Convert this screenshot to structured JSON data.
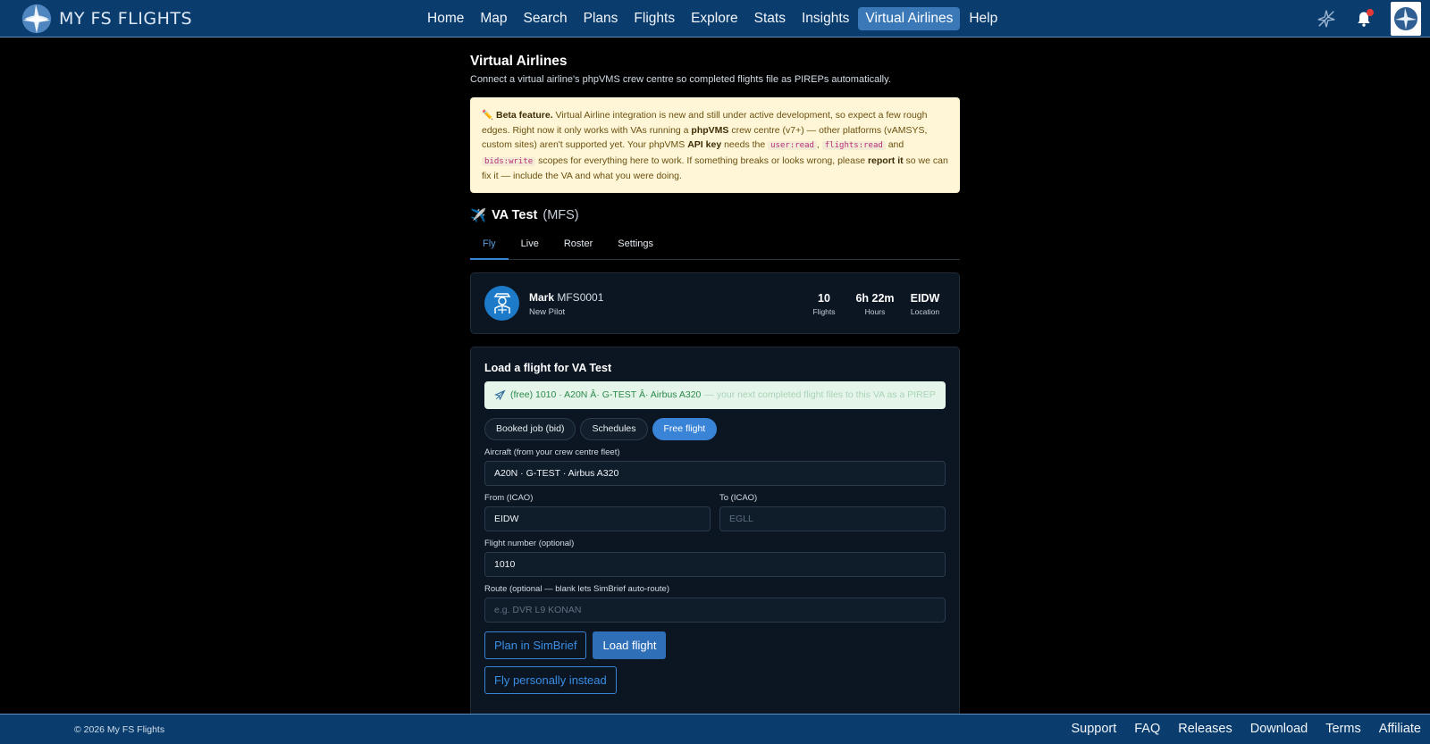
{
  "brand": {
    "name": "MY FS FLIGHTS"
  },
  "nav": {
    "items": [
      {
        "label": "Home"
      },
      {
        "label": "Map"
      },
      {
        "label": "Search"
      },
      {
        "label": "Plans"
      },
      {
        "label": "Flights"
      },
      {
        "label": "Explore"
      },
      {
        "label": "Stats"
      },
      {
        "label": "Insights"
      },
      {
        "label": "Virtual Airlines"
      },
      {
        "label": "Help"
      }
    ],
    "active": "Virtual Airlines"
  },
  "page": {
    "title": "Virtual Airlines",
    "subtitle": "Connect a virtual airline's phpVMS crew centre so completed flights file as PIREPs automatically."
  },
  "beta": {
    "label": "Beta feature.",
    "text1": " Virtual Airline integration is new and still under active development, so expect a few rough edges. Right now it only works with VAs running a ",
    "strong1": "phpVMS",
    "text2": " crew centre (v7+) — other platforms (vAMSYS, custom sites) aren't supported yet. Your phpVMS ",
    "strong2": "API key",
    "text3": " needs the ",
    "code1": "user:read",
    "sep1": ", ",
    "code2": "flights:read",
    "text4": " and ",
    "code3": "bids:write",
    "text5": " scopes for everything here to work. If something breaks or looks wrong, please ",
    "strong3": "report it",
    "text6": " so we can fix it — include the VA and what you were doing."
  },
  "va": {
    "name": "VA Test",
    "code": "(MFS)"
  },
  "tabs": [
    {
      "label": "Fly"
    },
    {
      "label": "Live"
    },
    {
      "label": "Roster"
    },
    {
      "label": "Settings"
    }
  ],
  "pilot": {
    "name": "Mark",
    "id": "MFS0001",
    "rank": "New Pilot",
    "stats": [
      {
        "value": "10",
        "label": "Flights"
      },
      {
        "value": "6h 22m",
        "label": "Hours"
      },
      {
        "value": "EIDW",
        "label": "Location"
      }
    ]
  },
  "load": {
    "title": "Load a flight for VA Test",
    "summary": "(free) 1010 · A20N Â· G-TEST Â· Airbus A320",
    "summary_hint": "— your next completed flight files to this VA as a PIREP",
    "modes": [
      {
        "label": "Booked job (bid)"
      },
      {
        "label": "Schedules"
      },
      {
        "label": "Free flight"
      }
    ],
    "active_mode": "Free flight",
    "aircraft_label": "Aircraft (from your crew centre fleet)",
    "aircraft_value": "A20N · G-TEST · Airbus A320",
    "from_label": "From (ICAO)",
    "from_value": "EIDW",
    "to_label": "To (ICAO)",
    "to_placeholder": "EGLL",
    "flight_number_label": "Flight number (optional)",
    "flight_number_value": "1010",
    "route_label": "Route (optional — blank lets SimBrief auto-route)",
    "route_placeholder": "e.g. DVR L9 KONAN",
    "plan_button": "Plan in SimBrief",
    "load_button": "Load flight",
    "personal_button": "Fly personally instead"
  },
  "footer": {
    "copyright": "© 2026 My FS Flights",
    "links": [
      {
        "label": "Support"
      },
      {
        "label": "FAQ"
      },
      {
        "label": "Releases"
      },
      {
        "label": "Download"
      },
      {
        "label": "Terms"
      },
      {
        "label": "Affiliate"
      }
    ]
  },
  "colors": {
    "nav_bg": "#0a3d6e",
    "accent": "#3a84d8",
    "beta_bg": "#fef6d6",
    "card_bg": "#0b1622"
  }
}
